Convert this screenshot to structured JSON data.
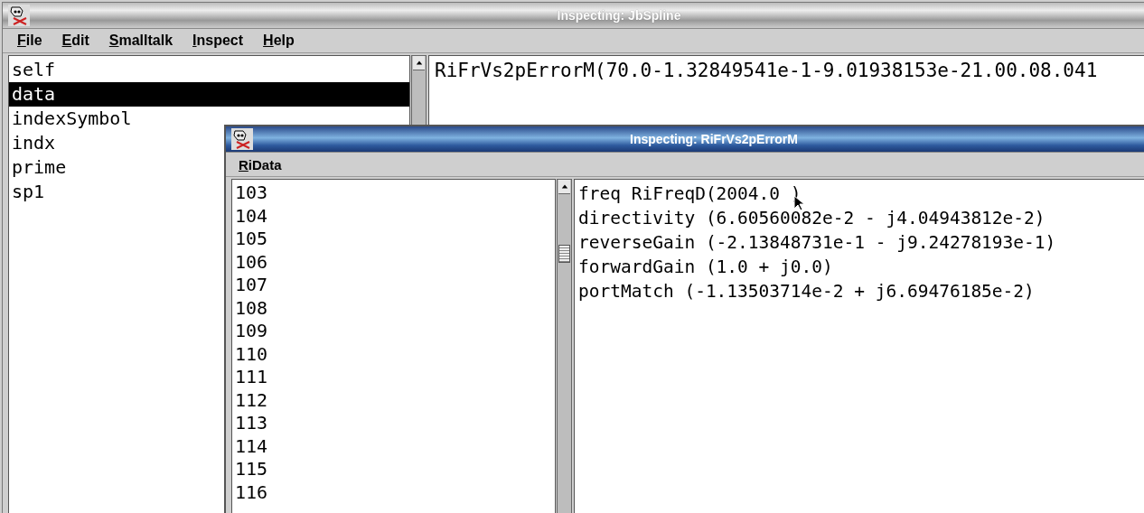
{
  "window": {
    "title": "Inspecting: JbSpline"
  },
  "menu": [
    "File",
    "Edit",
    "Smalltalk",
    "Inspect",
    "Help"
  ],
  "fields": [
    {
      "label": "self",
      "selected": false
    },
    {
      "label": "data",
      "selected": true
    },
    {
      "label": "indexSymbol",
      "selected": false
    },
    {
      "label": "indx",
      "selected": false
    },
    {
      "label": "prime",
      "selected": false
    },
    {
      "label": "sp1",
      "selected": false
    }
  ],
  "value_text": "RiFrVs2pErrorM(70.0-1.32849541e-1-9.01938153e-21.00.08.041",
  "inspector": {
    "title": "Inspecting: RiFrVs2pErrorM",
    "menu": [
      "RiData"
    ],
    "items": [
      {
        "label": "103",
        "selected": false
      },
      {
        "label": "104",
        "selected": false
      },
      {
        "label": "105",
        "selected": false
      },
      {
        "label": "106",
        "selected": false
      },
      {
        "label": "107",
        "selected": false
      },
      {
        "label": "108",
        "selected": false
      },
      {
        "label": "109",
        "selected": false
      },
      {
        "label": "110",
        "selected": false
      },
      {
        "label": "111",
        "selected": false
      },
      {
        "label": "112",
        "selected": false
      },
      {
        "label": "113",
        "selected": false
      },
      {
        "label": "114",
        "selected": false
      },
      {
        "label": "115",
        "selected": false
      },
      {
        "label": "116",
        "selected": false
      }
    ],
    "value_lines": [
      "freq RiFreqD(2004.0 )",
      "directivity (6.60560082e-2 - j4.04943812e-2)",
      "reverseGain (-2.13848731e-1 - j9.24278193e-1)",
      "forwardGain (1.0 + j0.0)",
      "portMatch (-1.13503714e-2 + j6.69476185e-2)"
    ]
  }
}
